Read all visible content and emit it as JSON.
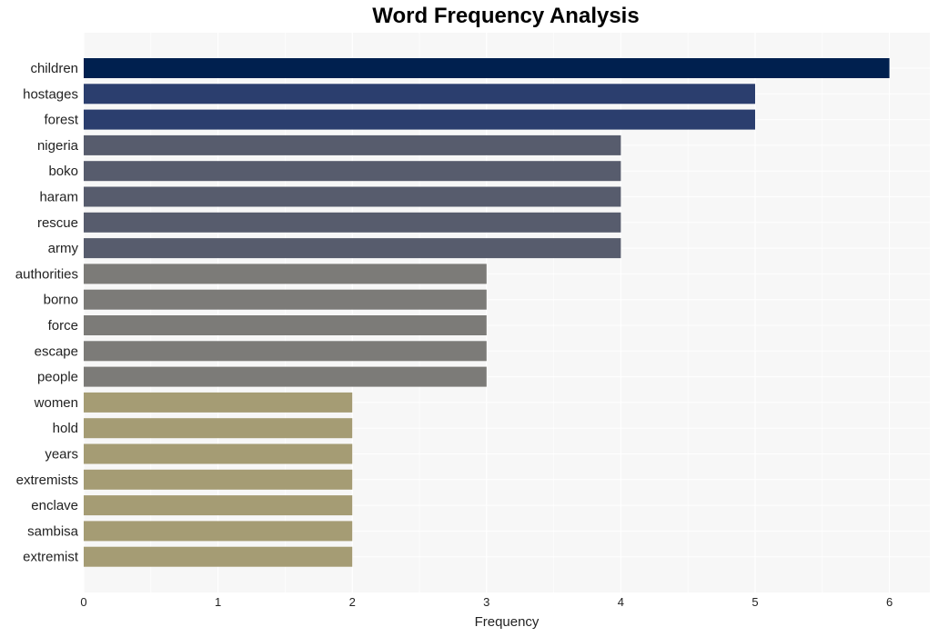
{
  "chart_data": {
    "type": "bar",
    "orientation": "horizontal",
    "title": "Word Frequency Analysis",
    "xlabel": "Frequency",
    "ylabel": "",
    "xlim": [
      0,
      6.3
    ],
    "xticks": [
      0,
      1,
      2,
      3,
      4,
      5,
      6
    ],
    "grid": true,
    "categories": [
      "children",
      "hostages",
      "forest",
      "nigeria",
      "boko",
      "haram",
      "rescue",
      "army",
      "authorities",
      "borno",
      "force",
      "escape",
      "people",
      "women",
      "hold",
      "years",
      "extremists",
      "enclave",
      "sambisa",
      "extremist"
    ],
    "values": [
      6,
      5,
      5,
      4,
      4,
      4,
      4,
      4,
      3,
      3,
      3,
      3,
      3,
      2,
      2,
      2,
      2,
      2,
      2,
      2
    ],
    "color_by_value": {
      "6": "#00204f",
      "5": "#2b3e6e",
      "4": "#575c6d",
      "3": "#7c7b78",
      "2": "#a59c74"
    },
    "background": "#f7f7f7"
  }
}
